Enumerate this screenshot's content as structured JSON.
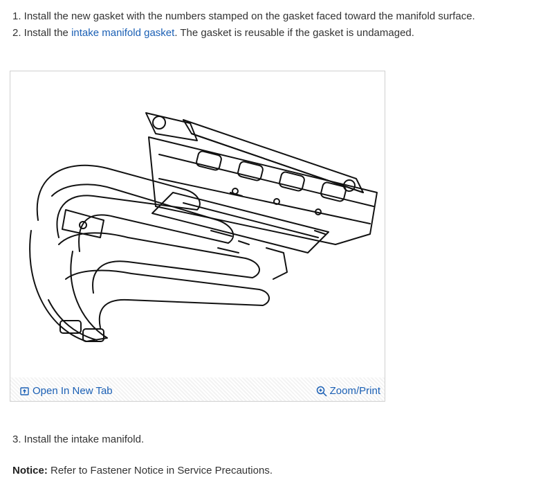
{
  "steps": {
    "step1": "1. Install the new gasket with the numbers stamped on the gasket faced toward the manifold surface.",
    "step2_prefix": "2. Install the ",
    "step2_link": "intake manifold gasket",
    "step2_suffix": ". The gasket is reusable if the gasket is undamaged.",
    "step3": "3. Install the intake manifold."
  },
  "figure": {
    "open_tab_label": "Open In New Tab",
    "zoom_print_label": "Zoom/Print"
  },
  "notice": {
    "label": "Notice:",
    "text": " Refer to Fastener Notice in Service Precautions."
  },
  "colors": {
    "link": "#1a5fb4",
    "text": "#333333"
  }
}
